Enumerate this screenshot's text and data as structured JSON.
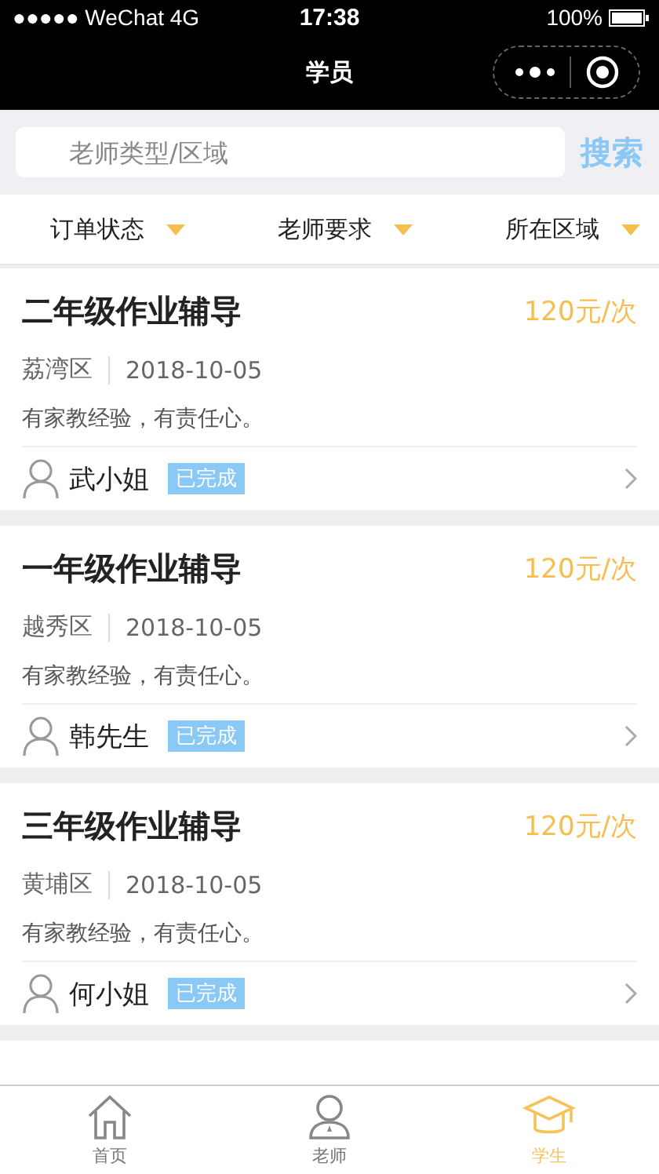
{
  "status_bar": {
    "carrier": "●●●●● WeChat 4G",
    "time": "17:38",
    "battery": "100%"
  },
  "nav": {
    "title": "学员"
  },
  "search": {
    "placeholder": "老师类型/区域",
    "button": "搜索"
  },
  "filters": [
    {
      "label": "订单状态"
    },
    {
      "label": "老师要求"
    },
    {
      "label": "所在区域"
    }
  ],
  "orders": [
    {
      "title": "二年级作业辅导",
      "price": "120元/次",
      "district": "荔湾区",
      "date": "2018-10-05",
      "note": "有家教经验，有责任心。",
      "name": "武小姐",
      "status": "已完成"
    },
    {
      "title": "一年级作业辅导",
      "price": "120元/次",
      "district": "越秀区",
      "date": "2018-10-05",
      "note": "有家教经验，有责任心。",
      "name": "韩先生",
      "status": "已完成"
    },
    {
      "title": "三年级作业辅导",
      "price": "120元/次",
      "district": "黄埔区",
      "date": "2018-10-05",
      "note": "有家教经验，有责任心。",
      "name": "何小姐",
      "status": "已完成"
    }
  ],
  "tab_bar": [
    {
      "label": "首页",
      "kind": "home",
      "selected": false
    },
    {
      "label": "老师",
      "kind": "teacher",
      "selected": false
    },
    {
      "label": "学生",
      "kind": "student",
      "selected": true
    }
  ]
}
